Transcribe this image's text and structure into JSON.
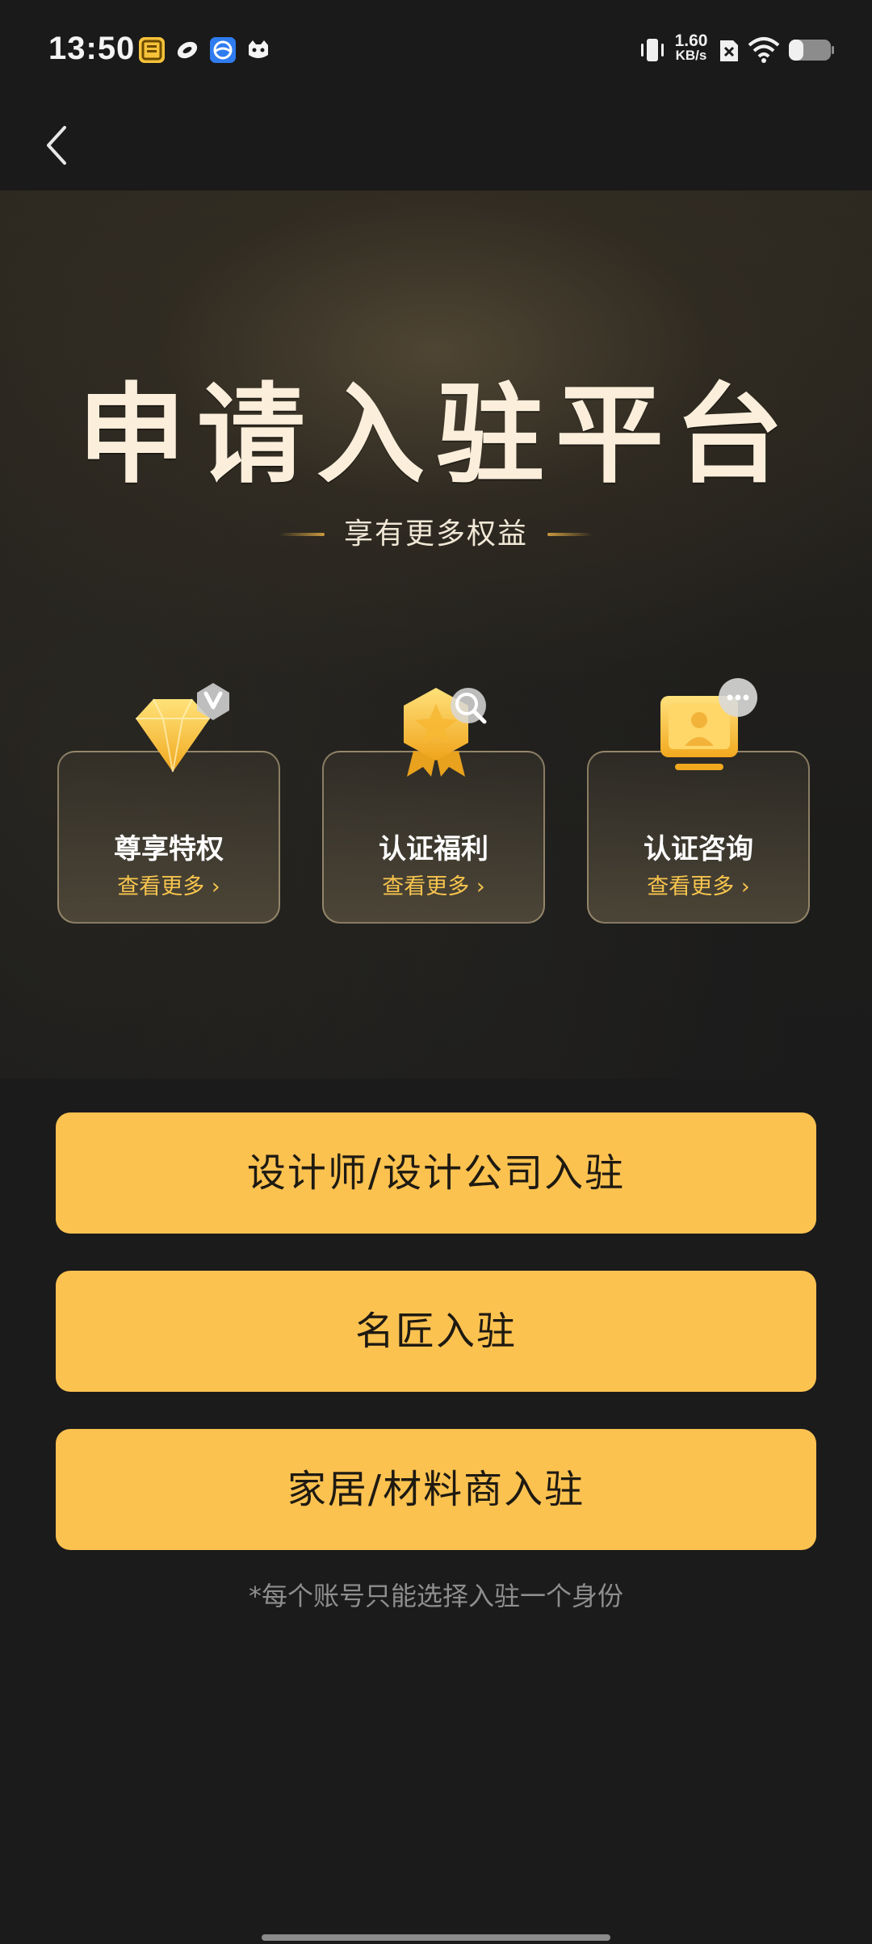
{
  "status_bar": {
    "time": "13:50",
    "net_speed_value": "1.60",
    "net_speed_unit": "KB/s",
    "app_icons": [
      "news-app-icon",
      "sina-app-icon",
      "browser-app-icon",
      "cat-app-icon"
    ],
    "right_icons": [
      "vibrate-icon",
      "no-sim-icon",
      "wifi-icon",
      "battery-icon"
    ]
  },
  "nav": {
    "back_icon": "chevron-left-icon"
  },
  "hero": {
    "title": "申请入驻平台",
    "subtitle": "享有更多权益"
  },
  "benefits": [
    {
      "title": "尊享特权",
      "more": "查看更多 ›",
      "icon": "diamond-v-icon"
    },
    {
      "title": "认证福利",
      "more": "查看更多 ›",
      "icon": "badge-search-icon"
    },
    {
      "title": "认证咨询",
      "more": "查看更多 ›",
      "icon": "consult-chat-icon"
    }
  ],
  "actions": [
    {
      "label": "设计师/设计公司入驻"
    },
    {
      "label": "名匠入驻"
    },
    {
      "label": "家居/材料商入驻"
    }
  ],
  "footnote": "*每个账号只能选择入驻一个身份",
  "colors": {
    "accent": "#fcc250",
    "link": "#f7c44d",
    "background": "#1b1b1b"
  }
}
